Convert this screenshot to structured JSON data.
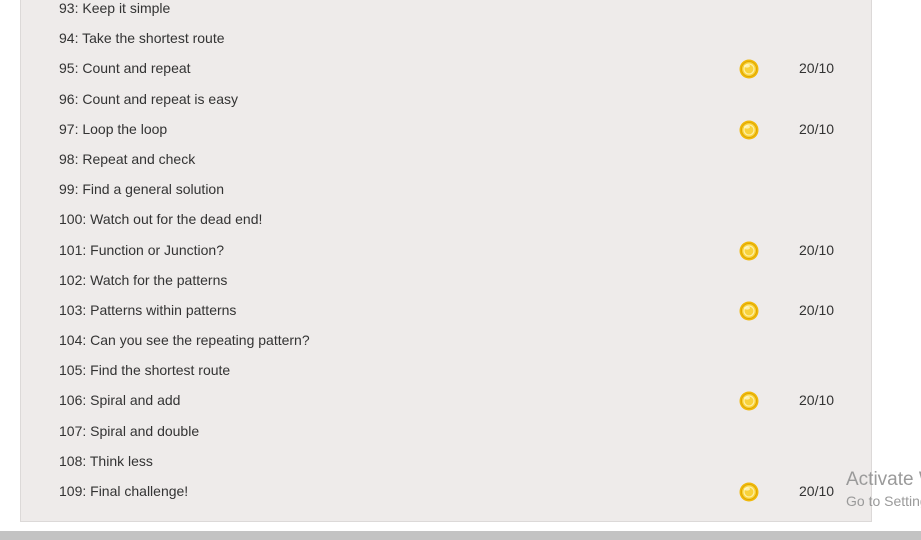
{
  "levels": [
    {
      "title": "93: Keep it simple",
      "score": ""
    },
    {
      "title": "94: Take the shortest route",
      "score": ""
    },
    {
      "title": "95: Count and repeat",
      "score": "20/10",
      "coin": true
    },
    {
      "title": "96: Count and repeat is easy",
      "score": ""
    },
    {
      "title": "97: Loop the loop",
      "score": "20/10",
      "coin": true
    },
    {
      "title": "98: Repeat and check",
      "score": ""
    },
    {
      "title": "99: Find a general solution",
      "score": ""
    },
    {
      "title": "100: Watch out for the dead end!",
      "score": ""
    },
    {
      "title": "101: Function or Junction?",
      "score": "20/10",
      "coin": true
    },
    {
      "title": "102: Watch for the patterns",
      "score": ""
    },
    {
      "title": "103: Patterns within patterns",
      "score": "20/10",
      "coin": true
    },
    {
      "title": "104: Can you see the repeating pattern?",
      "score": ""
    },
    {
      "title": "105: Find the shortest route",
      "score": ""
    },
    {
      "title": "106: Spiral and add",
      "score": "20/10",
      "coin": true
    },
    {
      "title": "107: Spiral and double",
      "score": ""
    },
    {
      "title": "108: Think less",
      "score": ""
    },
    {
      "title": "109: Final challenge!",
      "score": "20/10",
      "coin": true
    }
  ],
  "coin_icon": "gold-coin-icon",
  "colors": {
    "panel_bg": "#eeebea",
    "text": "#333333",
    "coin": "#f5c518",
    "bottom_bar": "#c3c3c3",
    "watermark": "#9a9a9a"
  },
  "watermark": {
    "title": "Activate Windows",
    "subtitle": "Go to Settings to activate Windows."
  }
}
